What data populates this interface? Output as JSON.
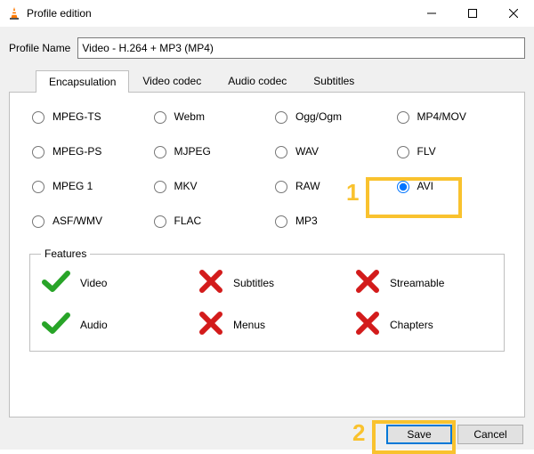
{
  "window": {
    "title": "Profile edition"
  },
  "profile": {
    "label": "Profile Name",
    "value": "Video - H.264 + MP3 (MP4)"
  },
  "tabs": [
    {
      "label": "Encapsulation",
      "active": true
    },
    {
      "label": "Video codec",
      "active": false
    },
    {
      "label": "Audio codec",
      "active": false
    },
    {
      "label": "Subtitles",
      "active": false
    }
  ],
  "encaps_options": [
    "MPEG-TS",
    "Webm",
    "Ogg/Ogm",
    "MP4/MOV",
    "MPEG-PS",
    "MJPEG",
    "WAV",
    "FLV",
    "MPEG 1",
    "MKV",
    "RAW",
    "AVI",
    "ASF/WMV",
    "FLAC",
    "MP3"
  ],
  "encaps_selected": "AVI",
  "features": {
    "legend": "Features",
    "items": [
      {
        "label": "Video",
        "ok": true
      },
      {
        "label": "Subtitles",
        "ok": false
      },
      {
        "label": "Streamable",
        "ok": false
      },
      {
        "label": "Audio",
        "ok": true
      },
      {
        "label": "Menus",
        "ok": false
      },
      {
        "label": "Chapters",
        "ok": false
      }
    ]
  },
  "buttons": {
    "save": "Save",
    "cancel": "Cancel"
  },
  "annotations": {
    "num1": "1",
    "num2": "2"
  }
}
